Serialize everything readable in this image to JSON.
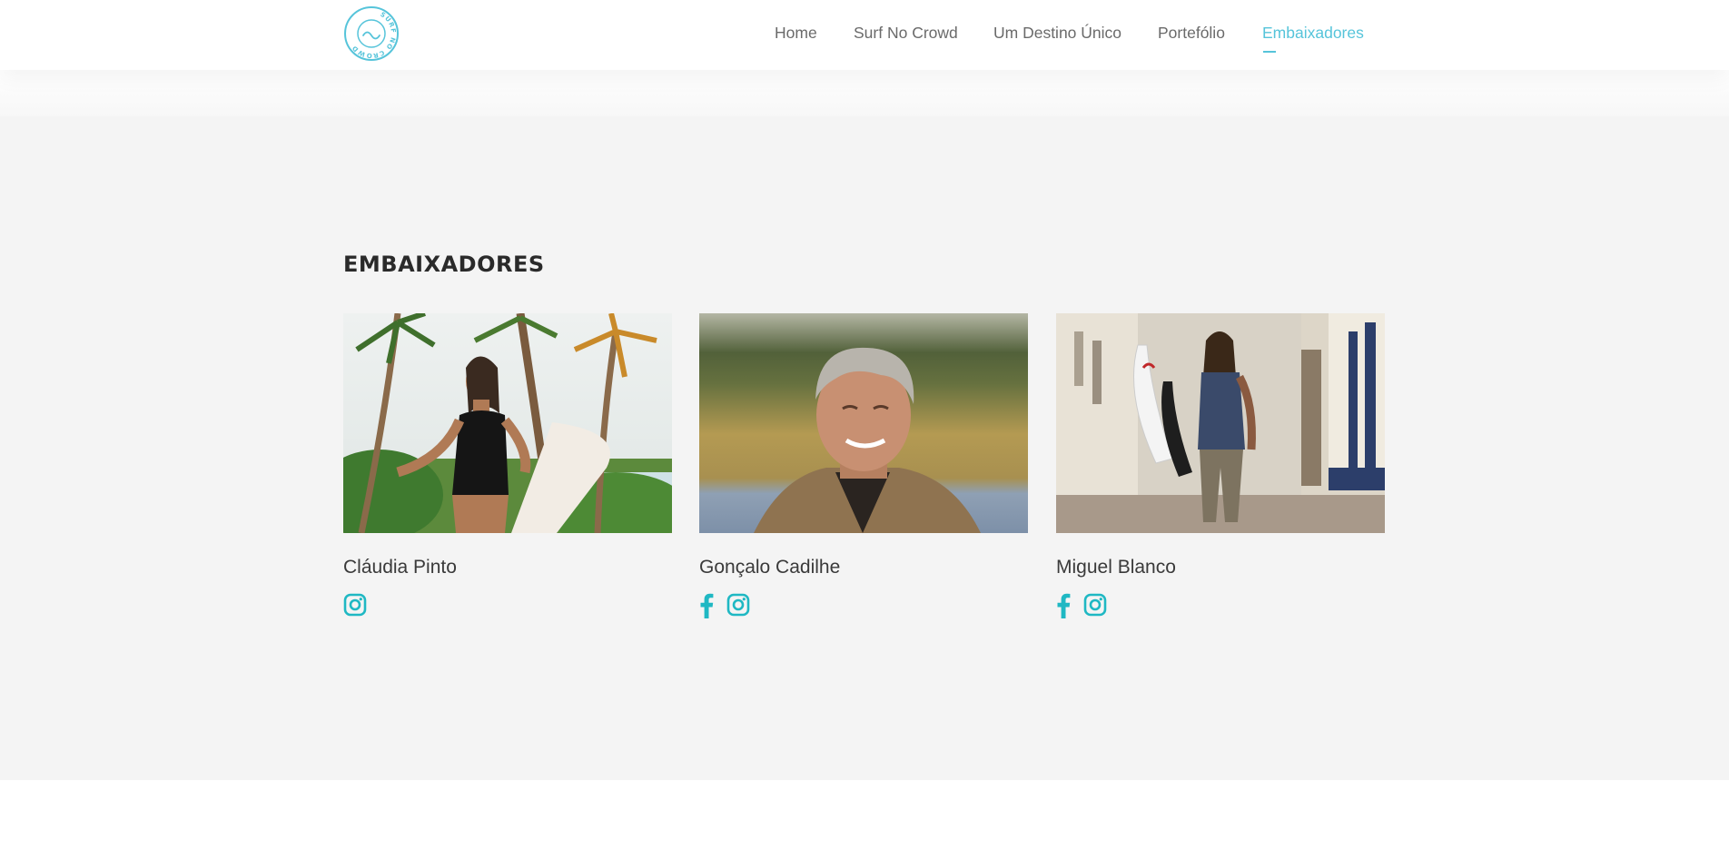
{
  "brand": {
    "logo_text": "SURF NO CROWD",
    "accent_color": "#56c4da",
    "icon_color": "#1fb8c3"
  },
  "nav": {
    "items": [
      {
        "label": "Home",
        "active": false
      },
      {
        "label": "Surf No Crowd",
        "active": false
      },
      {
        "label": "Um Destino Único",
        "active": false
      },
      {
        "label": "Portefólio",
        "active": false
      },
      {
        "label": "Embaixadores",
        "active": true
      }
    ]
  },
  "section": {
    "title": "EMBAIXADORES"
  },
  "ambassadors": [
    {
      "name": "Cláudia Pinto",
      "photo": "surfer-woman-with-board-on-beach",
      "socials": [
        "instagram-icon"
      ]
    },
    {
      "name": "Gonçalo Cadilhe",
      "photo": "smiling-man-portrait",
      "socials": [
        "facebook-icon",
        "instagram-icon"
      ]
    },
    {
      "name": "Miguel Blanco",
      "photo": "surfer-man-walking-street-with-board",
      "socials": [
        "facebook-icon",
        "instagram-icon"
      ]
    }
  ]
}
